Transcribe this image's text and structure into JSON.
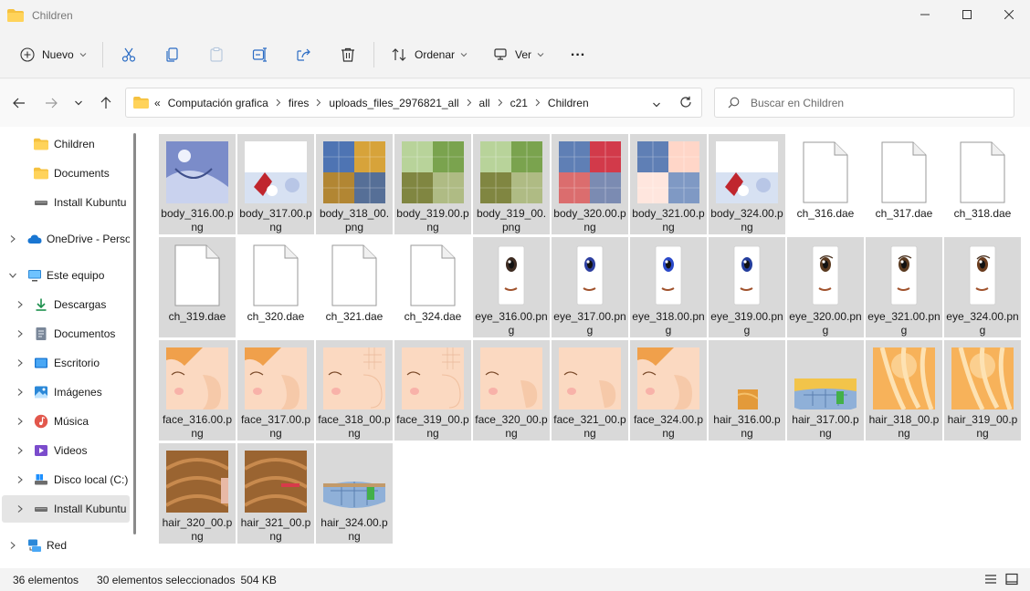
{
  "window": {
    "title": "Children"
  },
  "toolbar": {
    "new_label": "Nuevo",
    "sort_label": "Ordenar",
    "view_label": "Ver",
    "more_label": "..."
  },
  "address": {
    "overflow": "«",
    "crumbs": [
      "Computación grafica",
      "fires",
      "uploads_files_2976821_all",
      "all",
      "c21",
      "Children"
    ]
  },
  "search": {
    "placeholder": "Buscar en Children"
  },
  "nav": {
    "items": [
      {
        "label": "Children"
      },
      {
        "label": "Documents"
      },
      {
        "label": "Install Kubuntu"
      },
      {
        "label": "OneDrive - Perso"
      },
      {
        "label": "Este equipo"
      },
      {
        "label": "Descargas"
      },
      {
        "label": "Documentos"
      },
      {
        "label": "Escritorio"
      },
      {
        "label": "Imágenes"
      },
      {
        "label": "Música"
      },
      {
        "label": "Videos"
      },
      {
        "label": "Disco local (C:)"
      },
      {
        "label": "Install Kubuntu"
      },
      {
        "label": "Red"
      }
    ]
  },
  "files": [
    {
      "name": "body_316.00.png",
      "selected": true
    },
    {
      "name": "body_317.00.png",
      "selected": true
    },
    {
      "name": "body_318_00.png",
      "selected": true
    },
    {
      "name": "body_319.00.png",
      "selected": true
    },
    {
      "name": "body_319_00.png",
      "selected": true
    },
    {
      "name": "body_320.00.png",
      "selected": true
    },
    {
      "name": "body_321.00.png",
      "selected": true
    },
    {
      "name": "body_324.00.png",
      "selected": true
    },
    {
      "name": "ch_316.dae",
      "selected": false
    },
    {
      "name": "ch_317.dae",
      "selected": false
    },
    {
      "name": "ch_318.dae",
      "selected": false
    },
    {
      "name": "ch_319.dae",
      "selected": true
    },
    {
      "name": "ch_320.dae",
      "selected": false
    },
    {
      "name": "ch_321.dae",
      "selected": false
    },
    {
      "name": "ch_324.dae",
      "selected": false
    },
    {
      "name": "eye_316.00.png",
      "selected": true
    },
    {
      "name": "eye_317.00.png",
      "selected": true
    },
    {
      "name": "eye_318.00.png",
      "selected": true
    },
    {
      "name": "eye_319.00.png",
      "selected": true
    },
    {
      "name": "eye_320.00.png",
      "selected": true
    },
    {
      "name": "eye_321.00.png",
      "selected": true
    },
    {
      "name": "eye_324.00.png",
      "selected": true
    },
    {
      "name": "face_316.00.png",
      "selected": true
    },
    {
      "name": "face_317.00.png",
      "selected": true
    },
    {
      "name": "face_318_00.png",
      "selected": true
    },
    {
      "name": "face_319_00.png",
      "selected": true
    },
    {
      "name": "face_320_00.png",
      "selected": true
    },
    {
      "name": "face_321_00.png",
      "selected": true
    },
    {
      "name": "face_324.00.png",
      "selected": true
    },
    {
      "name": "hair_316.00.png",
      "selected": true
    },
    {
      "name": "hair_317.00.png",
      "selected": true
    },
    {
      "name": "hair_318_00.png",
      "selected": true
    },
    {
      "name": "hair_319_00.png",
      "selected": true
    },
    {
      "name": "hair_320_00.png",
      "selected": true
    },
    {
      "name": "hair_321_00.png",
      "selected": true
    },
    {
      "name": "hair_324.00.png",
      "selected": true
    }
  ],
  "status": {
    "count": "36 elementos",
    "selected": "30 elementos seleccionados",
    "size": "504 KB"
  }
}
